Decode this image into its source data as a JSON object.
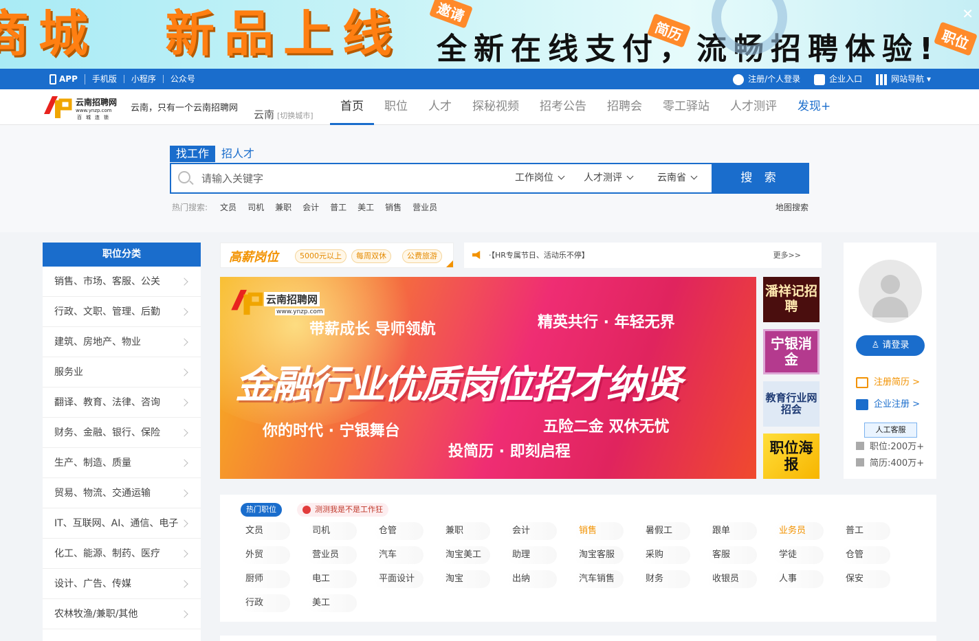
{
  "banner": {
    "part1": "商城",
    "part2": "新品上线",
    "sub": "全新在线支付，流畅招聘体验!",
    "tag1": "邀请",
    "tag2": "简历",
    "tag3": "职位"
  },
  "topbar": {
    "links": [
      "APP",
      "手机版",
      "小程序",
      "公众号"
    ],
    "register": "注册/个人登录",
    "enterprise": "企业入口",
    "sitenav": "网站导航"
  },
  "header": {
    "logo_name": "云南招聘网",
    "logo_url": "www.ynzp.com",
    "logo_chain": "百城连锁",
    "slogan": "云南，只有一个云南招聘网",
    "city": "云南",
    "switch_city": "[切换城市]",
    "nav": [
      "首页",
      "职位",
      "人才",
      "探秘视频",
      "招考公告",
      "招聘会",
      "零工驿站",
      "人才测评",
      "发现+"
    ]
  },
  "search": {
    "tab_job": "找工作",
    "tab_talent": "招人才",
    "placeholder": "请输入关键字",
    "drop_job": "工作岗位",
    "drop_eval": "人才测评",
    "drop_prov": "云南省",
    "button": "搜 索",
    "hot_label": "热门搜索:",
    "hot": [
      "文员",
      "司机",
      "兼职",
      "会计",
      "普工",
      "美工",
      "销售",
      "营业员"
    ],
    "map": "地图搜索"
  },
  "categories": {
    "title": "职位分类",
    "items": [
      "销售、市场、客服、公关",
      "行政、文职、管理、后勤",
      "建筑、房地产、物业",
      "服务业",
      "翻译、教育、法律、咨询",
      "财务、金融、银行、保险",
      "生产、制造、质量",
      "贸易、物流、交通运输",
      "IT、互联网、AI、通信、电子",
      "化工、能源、制药、医疗",
      "设计、广告、传媒",
      "农林牧渔/兼职/其他"
    ]
  },
  "gaoxin": {
    "title": "高薪岗位",
    "pills": [
      "5000元以上",
      "每周双休",
      "公费旅游"
    ]
  },
  "notice": {
    "text": "·【HR专属节日、活动乐不停】",
    "more": "更多>>"
  },
  "hero": {
    "logo_name": "云南招聘网",
    "logo_url": "www.ynzp.com",
    "line1": "带薪成长 导师领航",
    "line2": "精英共行 · 年轻无界",
    "main": "金融行业优质岗位招才纳贤",
    "line3": "你的时代 · 宁银舞台",
    "line4": "五险二金 双休无忧",
    "line5": "投简历 · 即刻启程"
  },
  "side_ads": [
    "潘祥记招聘",
    "宁银消金",
    "教育行业网招会",
    "职位海报"
  ],
  "user": {
    "login": "请登录",
    "reg_resume": "注册简历 >",
    "reg_company": "企业注册 >",
    "kefu": "人工客服",
    "jobs_stat": "职位:200万+",
    "resume_stat": "简历:400万+"
  },
  "hotjobs": {
    "tab": "热门职位",
    "test": "测测我是不是工作狂",
    "items": [
      {
        "t": "文员"
      },
      {
        "t": "司机"
      },
      {
        "t": "仓管"
      },
      {
        "t": "兼职"
      },
      {
        "t": "会计"
      },
      {
        "t": "销售",
        "hl": true
      },
      {
        "t": "暑假工"
      },
      {
        "t": "跟单"
      },
      {
        "t": "业务员",
        "hl": true
      },
      {
        "t": "普工"
      },
      {
        "t": "外贸"
      },
      {
        "t": "营业员"
      },
      {
        "t": "汽车"
      },
      {
        "t": "淘宝美工"
      },
      {
        "t": "助理"
      },
      {
        "t": "淘宝客服"
      },
      {
        "t": "采购"
      },
      {
        "t": "客服"
      },
      {
        "t": "学徒"
      },
      {
        "t": "仓管"
      },
      {
        "t": "厨师"
      },
      {
        "t": "电工"
      },
      {
        "t": "平面设计"
      },
      {
        "t": "淘宝"
      },
      {
        "t": "出纳"
      },
      {
        "t": "汽车销售"
      },
      {
        "t": "财务"
      },
      {
        "t": "收银员"
      },
      {
        "t": "人事"
      },
      {
        "t": "保安"
      },
      {
        "t": "行政"
      },
      {
        "t": "美工"
      }
    ]
  },
  "colors": {
    "brand": "#1a6dcc",
    "accent": "#f29200"
  }
}
